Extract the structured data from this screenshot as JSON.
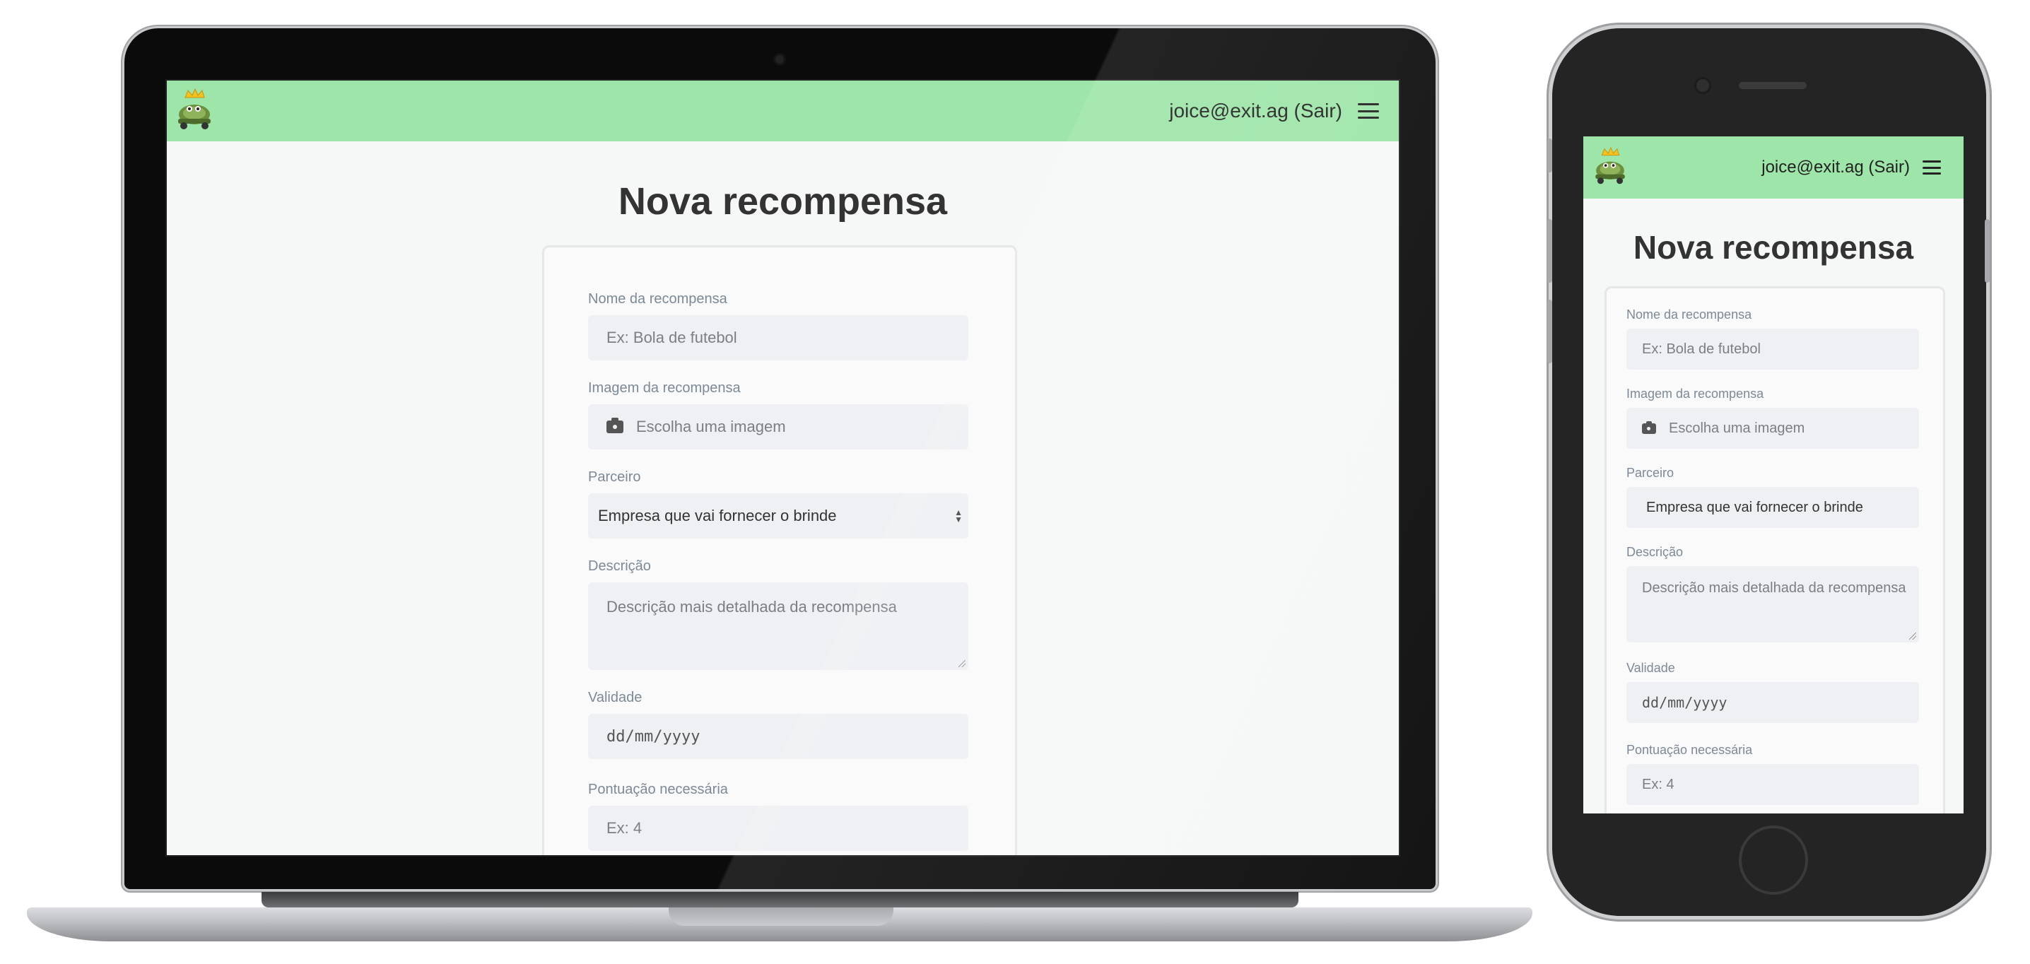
{
  "app": {
    "user_label": "joice@exit.ag (Sair)",
    "page_title": "Nova recompensa",
    "colors": {
      "header_bg": "#9de5a8",
      "input_bg": "#eef0f3",
      "label": "#7c8a96"
    },
    "icons": {
      "logo": "turtle-king-logo-icon",
      "menu": "hamburger-menu-icon",
      "image_upload": "camera-icon"
    }
  },
  "form": {
    "name": {
      "label": "Nome da recompensa",
      "placeholder": "Ex: Bola de futebol"
    },
    "image": {
      "label": "Imagem da recompensa",
      "button_label": "Escolha uma imagem"
    },
    "partner": {
      "label": "Parceiro",
      "selected": "Empresa que vai fornecer o brinde"
    },
    "description": {
      "label": "Descrição",
      "placeholder": "Descrição mais detalhada da recompensa"
    },
    "validity": {
      "label": "Validade",
      "placeholder": "dd/mm/yyyy"
    },
    "points": {
      "label": "Pontuação necessária",
      "placeholder": "Ex: 4"
    }
  }
}
